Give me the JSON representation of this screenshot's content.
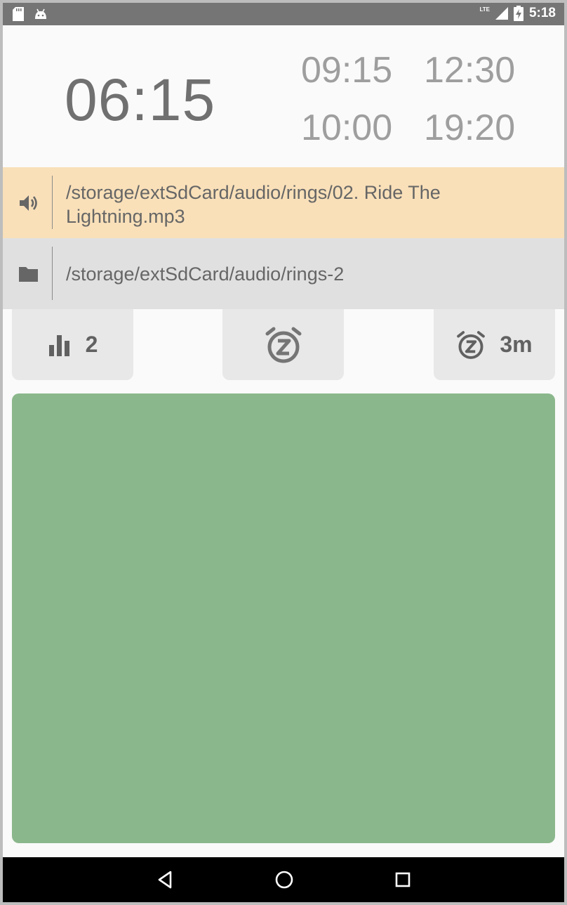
{
  "status_bar": {
    "time": "5:18",
    "network": "LTE",
    "icons": [
      "sd-card-icon",
      "android-icon",
      "signal-icon",
      "battery-charging-icon"
    ]
  },
  "alarms": {
    "main": "06:15",
    "others": [
      "09:15",
      "12:30",
      "10:00",
      "19:20"
    ]
  },
  "sound_row": {
    "icon": "volume-icon",
    "path": "/storage/extSdCard/audio/rings/02. Ride The Lightning.mp3"
  },
  "folder_row": {
    "icon": "folder-icon",
    "path": "/storage/extSdCard/audio/rings-2"
  },
  "buttons": {
    "volume_level": "2",
    "snooze_duration": "3m"
  },
  "colors": {
    "sound_row_bg": "#f9e0b9",
    "folder_row_bg": "#e0e0e0",
    "panel": "#8bb78c",
    "status_bar": "#757575"
  },
  "nav": [
    "back-icon",
    "home-icon",
    "recents-icon"
  ]
}
